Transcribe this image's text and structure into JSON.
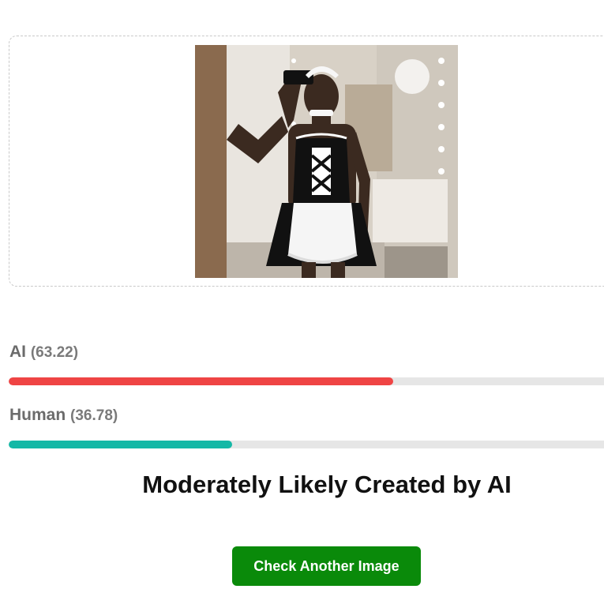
{
  "upload": {
    "preview_alt": "uploaded photo"
  },
  "results": {
    "ai": {
      "label": "AI",
      "score_text": "(63.22)",
      "score": 63.22,
      "color": "#ef4444"
    },
    "human": {
      "label": "Human",
      "score_text": "(36.78)",
      "score": 36.78,
      "color": "#14b8a6"
    }
  },
  "verdict": "Moderately Likely Created by AI",
  "actions": {
    "check_another_label": "Check Another Image"
  }
}
